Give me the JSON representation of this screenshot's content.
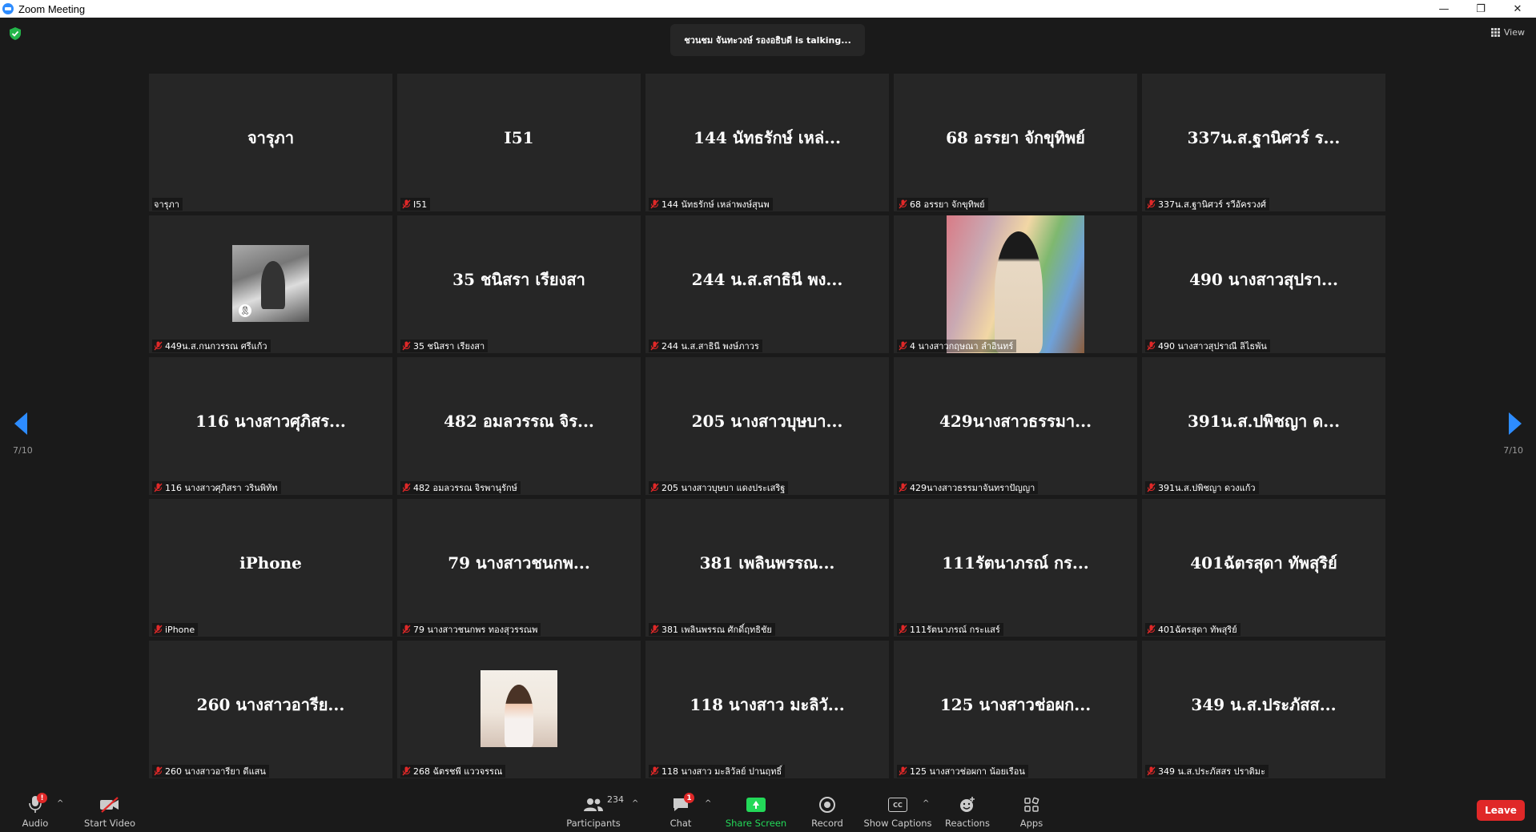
{
  "window": {
    "title": "Zoom Meeting",
    "controls": [
      "—",
      "❐",
      "✕"
    ]
  },
  "header": {
    "talking": "ชวนชม จันทะวงษ์ รองอธิบดี is  talking...",
    "view_label": "View"
  },
  "pagination": {
    "left_label": "7/10",
    "right_label": "7/10"
  },
  "tiles": [
    {
      "big": "จารุภา",
      "caption": "จารุภา",
      "muted": false
    },
    {
      "big": "I51",
      "caption": "I51",
      "muted": true
    },
    {
      "big": "144 นัทธรักษ์ เหล่...",
      "caption": "144 นัทธรักษ์ เหล่าพงษ์สุนพ",
      "muted": true
    },
    {
      "big": "68 อรรยา   จักขุทิพย์",
      "caption": "68 อรรยา   จักขุทิพย์",
      "muted": true
    },
    {
      "big": "337น.ส.ฐานิศวร์ ร...",
      "caption": "337น.ส.ฐานิศวร์ รวีอัครวงศ์",
      "muted": true
    },
    {
      "big": "",
      "caption": "449น.ส.กนกวรรณ ศรีแก้ว",
      "muted": true,
      "photo": "p1"
    },
    {
      "big": "35 ชนิสรา เรียงสา",
      "caption": "35 ชนิสรา เรียงสา",
      "muted": true
    },
    {
      "big": "244 น.ส.สาธินี พง...",
      "caption": "244 น.ส.สาธินี พงษ์ภาวร",
      "muted": true
    },
    {
      "big": "",
      "caption": "4 นางสาวกฤษณา ลำอินทร์",
      "muted": true,
      "photo": "p2"
    },
    {
      "big": "490 นางสาวสุปรา...",
      "caption": "490 นางสาวสุปราณี  ลิไธพัน",
      "muted": true
    },
    {
      "big": "116 นางสาวศุภิสร...",
      "caption": "116 นางสาวศุภิสรา วรินพิทัท",
      "muted": true
    },
    {
      "big": "482 อมลวรรณ จิร...",
      "caption": "482 อมลวรรณ จิรพานุรักษ์",
      "muted": true
    },
    {
      "big": "205 นางสาวบุษบา...",
      "caption": "205 นางสาวบุษบา แดงประเสริฐ",
      "muted": true
    },
    {
      "big": "429นางสาวธรรมา...",
      "caption": "429นางสาวธรรมาจันทราปัญญา",
      "muted": true
    },
    {
      "big": "391น.ส.ปพิชญา ด...",
      "caption": "391น.ส.ปพิชญา ดวงแก้ว",
      "muted": true
    },
    {
      "big": "iPhone",
      "caption": "iPhone",
      "muted": true
    },
    {
      "big": "79 นางสาวชนกพ...",
      "caption": "79 นางสาวชนกพร ทองสุวรรณพ",
      "muted": true
    },
    {
      "big": "381 เพลินพรรณ...",
      "caption": "381 เพลินพรรณ ศักดิ์ฤทธิชัย",
      "muted": true
    },
    {
      "big": "111รัตนาภรณ์ กร...",
      "caption": "111รัตนาภรณ์ กระแสร์",
      "muted": true
    },
    {
      "big": "401ฉัตรสุดา ทัพสุริย์",
      "caption": "401ฉัตรสุดา ทัพสุริย์",
      "muted": true
    },
    {
      "big": "260 นางสาวอารีย...",
      "caption": "260 นางสาวอารียา ดีแสน",
      "muted": true
    },
    {
      "big": "",
      "caption": "268 ฉัตรชพี แววจรรณ",
      "muted": true,
      "photo": "p3"
    },
    {
      "big": "118 นางสาว มะลิวั...",
      "caption": "118 นางสาว มะลิวัลย์ ปานฤทธิ์",
      "muted": true
    },
    {
      "big": "125 นางสาวช่อผก...",
      "caption": "125 นางสาวช่อผกา น้อยเรือน",
      "muted": true
    },
    {
      "big": "349 น.ส.ประภัสส...",
      "caption": "349 น.ส.ประภัสสร ปราติมะ",
      "muted": true
    }
  ],
  "toolbar": {
    "audio": "Audio",
    "audio_badge": "!",
    "start_video": "Start Video",
    "participants": "Participants",
    "participants_count": "234",
    "chat": "Chat",
    "chat_badge": "1",
    "share_screen": "Share Screen",
    "record": "Record",
    "show_captions": "Show Captions",
    "cc_text": "CC",
    "reactions": "Reactions",
    "apps": "Apps",
    "leave": "Leave"
  },
  "colors": {
    "accent": "#2d8cff",
    "share_green": "#23d959",
    "leave_red": "#e02828",
    "tile_bg": "#262626",
    "bg": "#1a1a1a"
  }
}
